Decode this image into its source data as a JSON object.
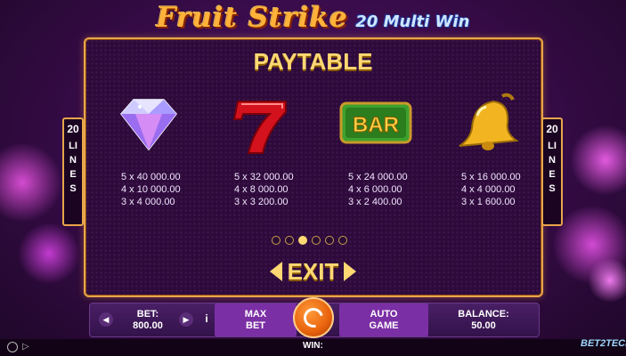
{
  "logo": {
    "main": "Fruit Strike",
    "sub": "20 Multi Win"
  },
  "paytable": {
    "title": "PAYTABLE",
    "lines_left": {
      "number": "20",
      "word": "LINES"
    },
    "lines_right": {
      "number": "20",
      "word": "LINES"
    },
    "symbols": [
      {
        "icon": "diamond-icon",
        "pays": [
          "5 x 40 000.00",
          "4 x 10 000.00",
          "3 x 4 000.00"
        ]
      },
      {
        "icon": "seven-icon",
        "pays": [
          "5 x 32 000.00",
          "4 x 8 000.00",
          "3 x 3 200.00"
        ]
      },
      {
        "icon": "bar-icon",
        "label": "BAR",
        "pays": [
          "5 x 24 000.00",
          "4 x 6 000.00",
          "3 x 2 400.00"
        ]
      },
      {
        "icon": "bell-icon",
        "pays": [
          "5 x 16 000.00",
          "4 x 4 000.00",
          "3 x 1 600.00"
        ]
      }
    ],
    "page_count": 6,
    "active_page": 3,
    "exit_label": "EXIT"
  },
  "controls": {
    "bet_label": "BET:",
    "bet_value": "800.00",
    "info_label": "i",
    "max_bet": "MAX BET",
    "auto_game": "AUTO GAME",
    "balance_label": "BALANCE:",
    "balance_value": "50.00",
    "win_label": "WIN:"
  },
  "brand": "BET2TECH"
}
